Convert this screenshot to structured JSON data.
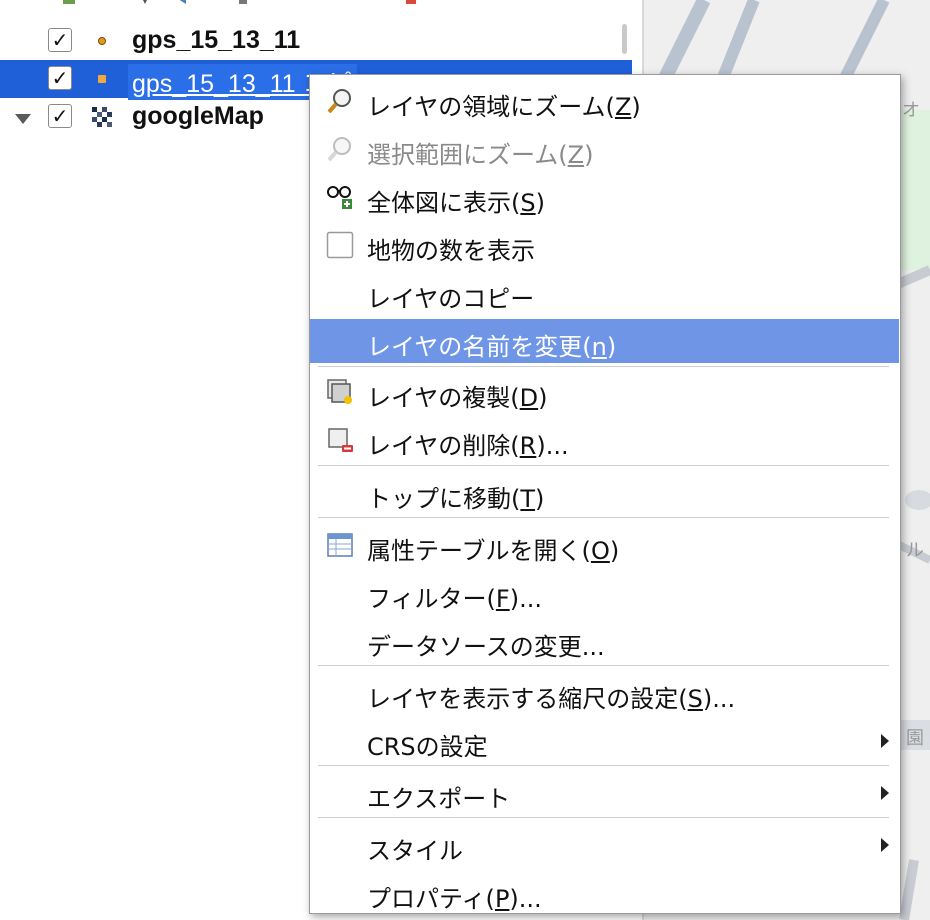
{
  "layers": [
    {
      "name": "gps_15_13_11",
      "checked": "✓",
      "type": "point",
      "selected": false
    },
    {
      "name": "gps_15_13_11 コピ",
      "checked": "✓",
      "type": "point",
      "selected": true
    },
    {
      "name": "googleMap",
      "checked": "✓",
      "type": "raster",
      "selected": false
    }
  ],
  "menu": {
    "zoom_to_layer": {
      "text": "レイヤの領域にズーム(",
      "key": "Z",
      "tail": ")"
    },
    "zoom_to_selection": {
      "text": "選択範囲にズーム(",
      "key": "Z",
      "tail": ")"
    },
    "show_in_overview": {
      "text": "全体図に表示(",
      "key": "S",
      "tail": ")"
    },
    "show_feature_count": {
      "text": "地物の数を表示"
    },
    "copy_layer": {
      "text": "レイヤのコピー"
    },
    "rename_layer": {
      "text": "レイヤの名前を変更(",
      "key": "n",
      "tail": ")"
    },
    "duplicate_layer": {
      "text": "レイヤの複製(",
      "key": "D",
      "tail": ")"
    },
    "remove_layer": {
      "text": "レイヤの削除(",
      "key": "R",
      "tail": ")..."
    },
    "move_to_top": {
      "text": "トップに移動(",
      "key": "T",
      "tail": ")"
    },
    "open_attribute_table": {
      "text": "属性テーブルを開く(",
      "key": "O",
      "tail": ")"
    },
    "filter": {
      "text": "フィルター(",
      "key": "F",
      "tail": ")..."
    },
    "change_data_source": {
      "text": "データソースの変更..."
    },
    "set_scale_visibility": {
      "text": "レイヤを表示する縮尺の設定(",
      "key": "S",
      "tail": ")..."
    },
    "set_crs": {
      "text": "CRSの設定"
    },
    "export": {
      "text": "エクスポート"
    },
    "styles": {
      "text": "スタイル"
    },
    "properties": {
      "text": "プロパティ(",
      "key": "P",
      "tail": ")..."
    }
  },
  "map_labels": [
    "オ",
    "ル",
    "園"
  ],
  "colors": {
    "selection": "#1f5fd8",
    "menu_highlight": "#6f95e6",
    "point_symbol": "#e39a1c"
  }
}
